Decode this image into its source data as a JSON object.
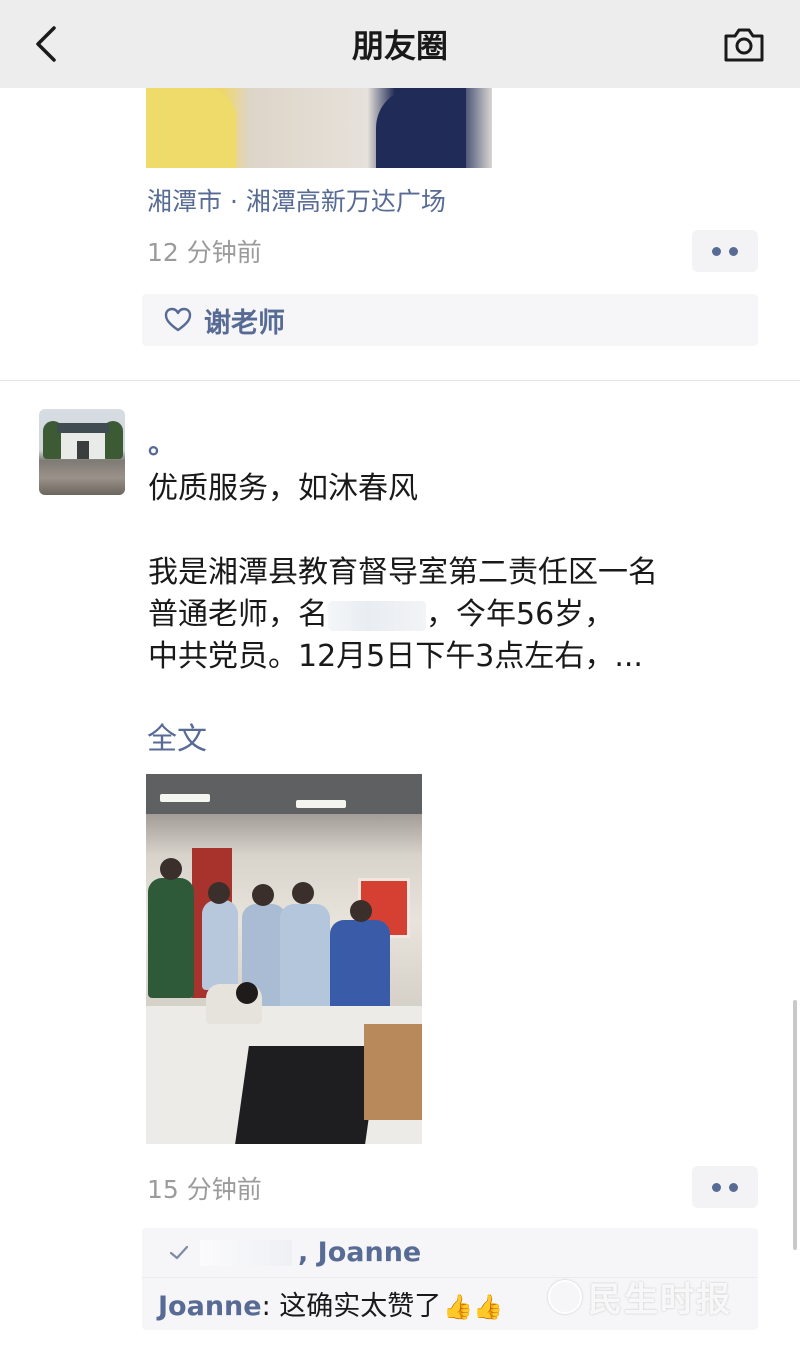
{
  "header": {
    "title": "朋友圈",
    "back_icon": "chevron-left-icon",
    "camera_icon": "camera-icon"
  },
  "post1": {
    "location": "湘潭市 · 湘潭高新万达广场",
    "time": "12 分钟前",
    "likes": {
      "icon": "heart-outline-icon",
      "names": "谢老师"
    }
  },
  "post2": {
    "user_name": "。",
    "text_lines": [
      "优质服务，如沐春风",
      "",
      "我是湘潭县教育督导室第二责任区一名",
      "普通老师，名",
      "，今年56岁，",
      "中共党员。12月5日下午3点左右，..."
    ],
    "full_text_link": "全文",
    "time": "15 分钟前",
    "likes": {
      "icon": "check-like-icon",
      "names": ", Joanne"
    },
    "comments": [
      {
        "author": "Joanne",
        "separator": ": ",
        "text": "这确实太赞了",
        "emoji": "👍👍"
      }
    ]
  },
  "watermark": {
    "text": "民生时报"
  },
  "colors": {
    "link": "#576b95",
    "muted": "#9b9b9b",
    "header_bg": "#ededed",
    "panel_bg": "#f6f6f8"
  }
}
